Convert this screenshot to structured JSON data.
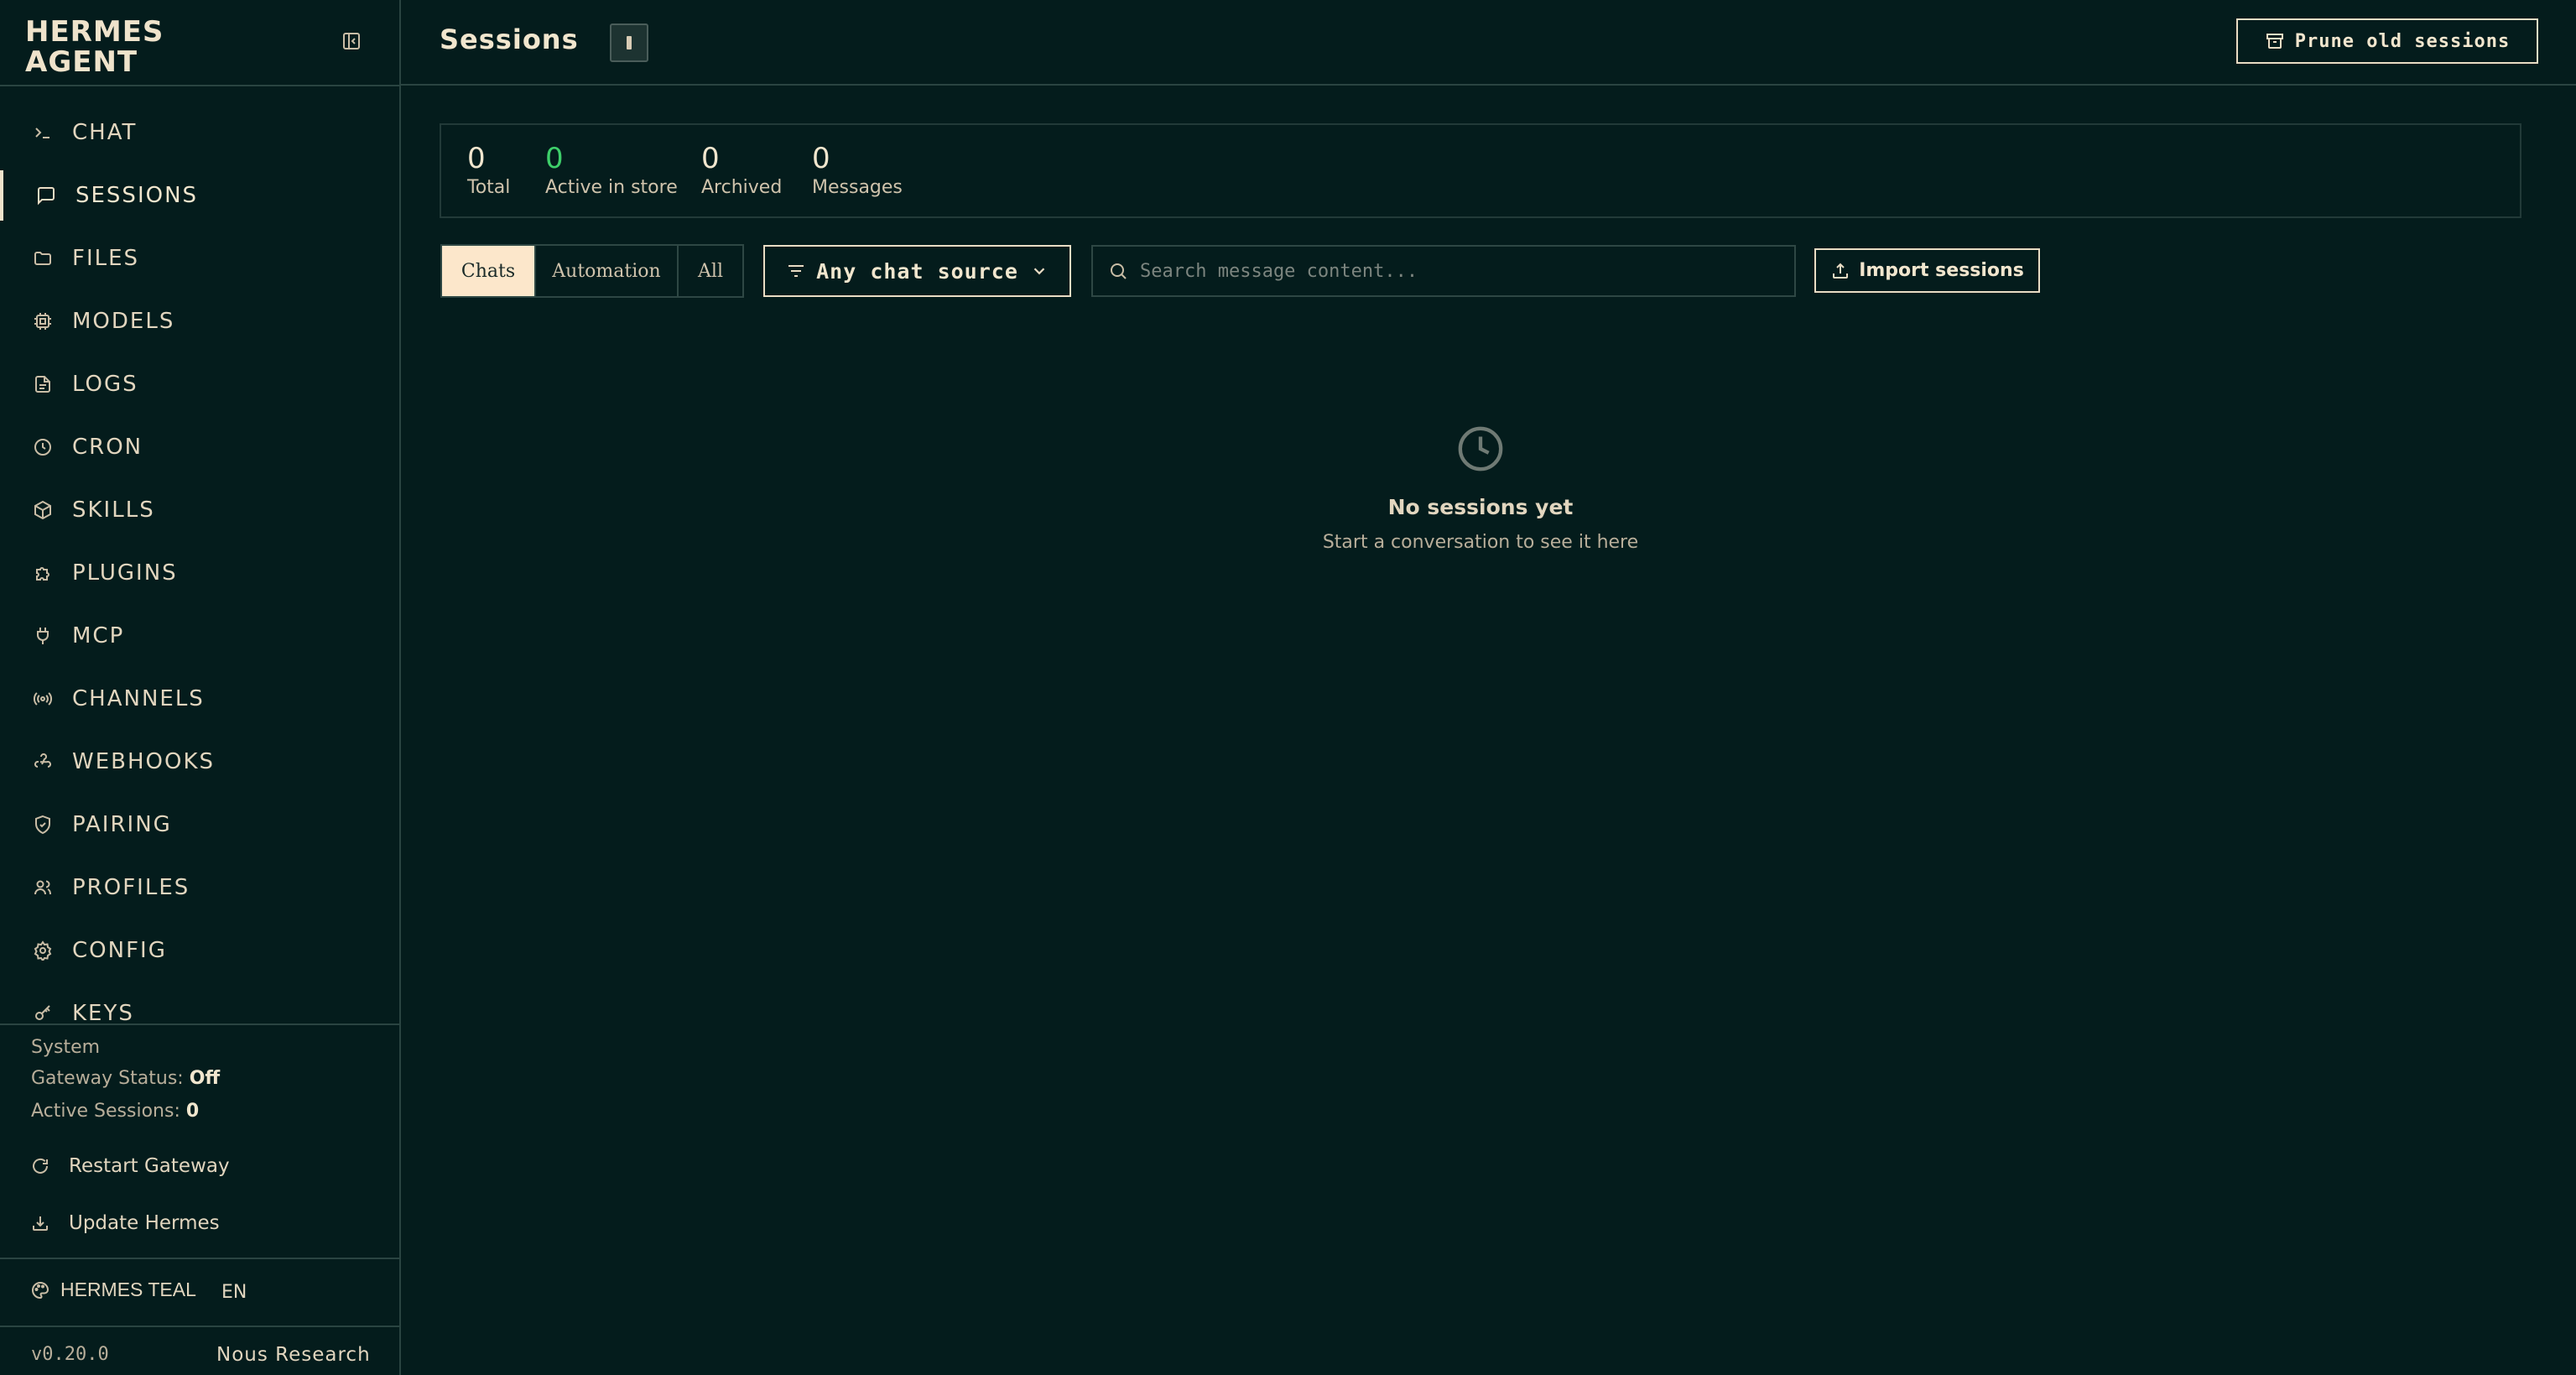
{
  "brand": {
    "line1": "HERMES",
    "line2": "AGENT"
  },
  "nav": {
    "items": [
      {
        "label": "CHAT",
        "icon": "terminal-icon"
      },
      {
        "label": "SESSIONS",
        "icon": "message-square-icon",
        "active": true
      },
      {
        "label": "FILES",
        "icon": "folder-icon"
      },
      {
        "label": "MODELS",
        "icon": "cpu-icon"
      },
      {
        "label": "LOGS",
        "icon": "file-text-icon"
      },
      {
        "label": "CRON",
        "icon": "clock-icon"
      },
      {
        "label": "SKILLS",
        "icon": "package-icon"
      },
      {
        "label": "PLUGINS",
        "icon": "puzzle-icon"
      },
      {
        "label": "MCP",
        "icon": "plug-icon"
      },
      {
        "label": "CHANNELS",
        "icon": "radio-icon"
      },
      {
        "label": "WEBHOOKS",
        "icon": "webhook-icon"
      },
      {
        "label": "PAIRING",
        "icon": "shield-check-icon"
      },
      {
        "label": "PROFILES",
        "icon": "users-icon"
      },
      {
        "label": "CONFIG",
        "icon": "settings-icon"
      },
      {
        "label": "KEYS",
        "icon": "key-icon"
      }
    ]
  },
  "system": {
    "heading": "System",
    "gateway_label": "Gateway Status:",
    "gateway_value": "Off",
    "active_label": "Active Sessions:",
    "active_value": "0",
    "restart_label": "Restart Gateway",
    "update_label": "Update Hermes"
  },
  "footer": {
    "theme": "HERMES TEAL",
    "language": "EN",
    "version": "v0.20.0",
    "org": "Nous Research"
  },
  "header": {
    "title": "Sessions",
    "prune_label": "Prune old sessions"
  },
  "stats": [
    {
      "value": "0",
      "label": "Total"
    },
    {
      "value": "0",
      "label": "Active in store",
      "color": "#3ecf6a"
    },
    {
      "value": "0",
      "label": "Archived"
    },
    {
      "value": "0",
      "label": "Messages"
    }
  ],
  "filters": {
    "tabs": [
      "Chats",
      "Automation",
      "All"
    ],
    "active_tab": "Chats",
    "source_label": "Any chat source",
    "search_placeholder": "Search message content...",
    "import_label": "Import sessions"
  },
  "empty": {
    "title": "No sessions yet",
    "subtitle": "Start a conversation to see it here"
  },
  "colors": {
    "background": "#041c1c",
    "text": "#e9dcc4",
    "accent": "#fce7cb",
    "success": "#3ecf6a"
  }
}
